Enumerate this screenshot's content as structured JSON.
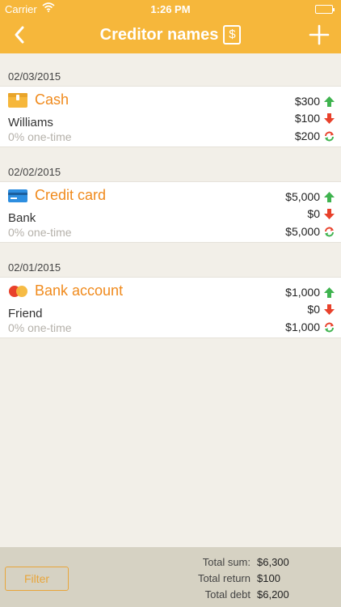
{
  "status_bar": {
    "carrier": "Carrier",
    "time": "1:26 PM"
  },
  "nav": {
    "title": "Creditor names",
    "title_badge": "$",
    "back_icon": "chevron-left-icon",
    "add_icon": "plus-icon"
  },
  "colors": {
    "header": "#f6b73b",
    "accent": "#f08a1c",
    "up": "#3fb34f",
    "down": "#e8412b"
  },
  "entries": [
    {
      "date": "02/03/2015",
      "icon": "wallet-icon",
      "name": "Cash",
      "person": "Williams",
      "rate": "0% one-time",
      "sum": "$300",
      "return": "$100",
      "debt": "$200"
    },
    {
      "date": "02/02/2015",
      "icon": "credit-card-icon",
      "name": "Credit card",
      "person": "Bank",
      "rate": "0% one-time",
      "sum": "$5,000",
      "return": "$0",
      "debt": "$5,000"
    },
    {
      "date": "02/01/2015",
      "icon": "bank-account-icon",
      "name": "Bank account",
      "person": "Friend",
      "rate": "0% one-time",
      "sum": "$1,000",
      "return": "$0",
      "debt": "$1,000"
    }
  ],
  "footer": {
    "filter_label": "Filter",
    "total_sum_label": "Total sum:",
    "total_sum": "$6,300",
    "total_return_label": "Total return",
    "total_return": "$100",
    "total_debt_label": "Total debt",
    "total_debt": "$6,200"
  }
}
